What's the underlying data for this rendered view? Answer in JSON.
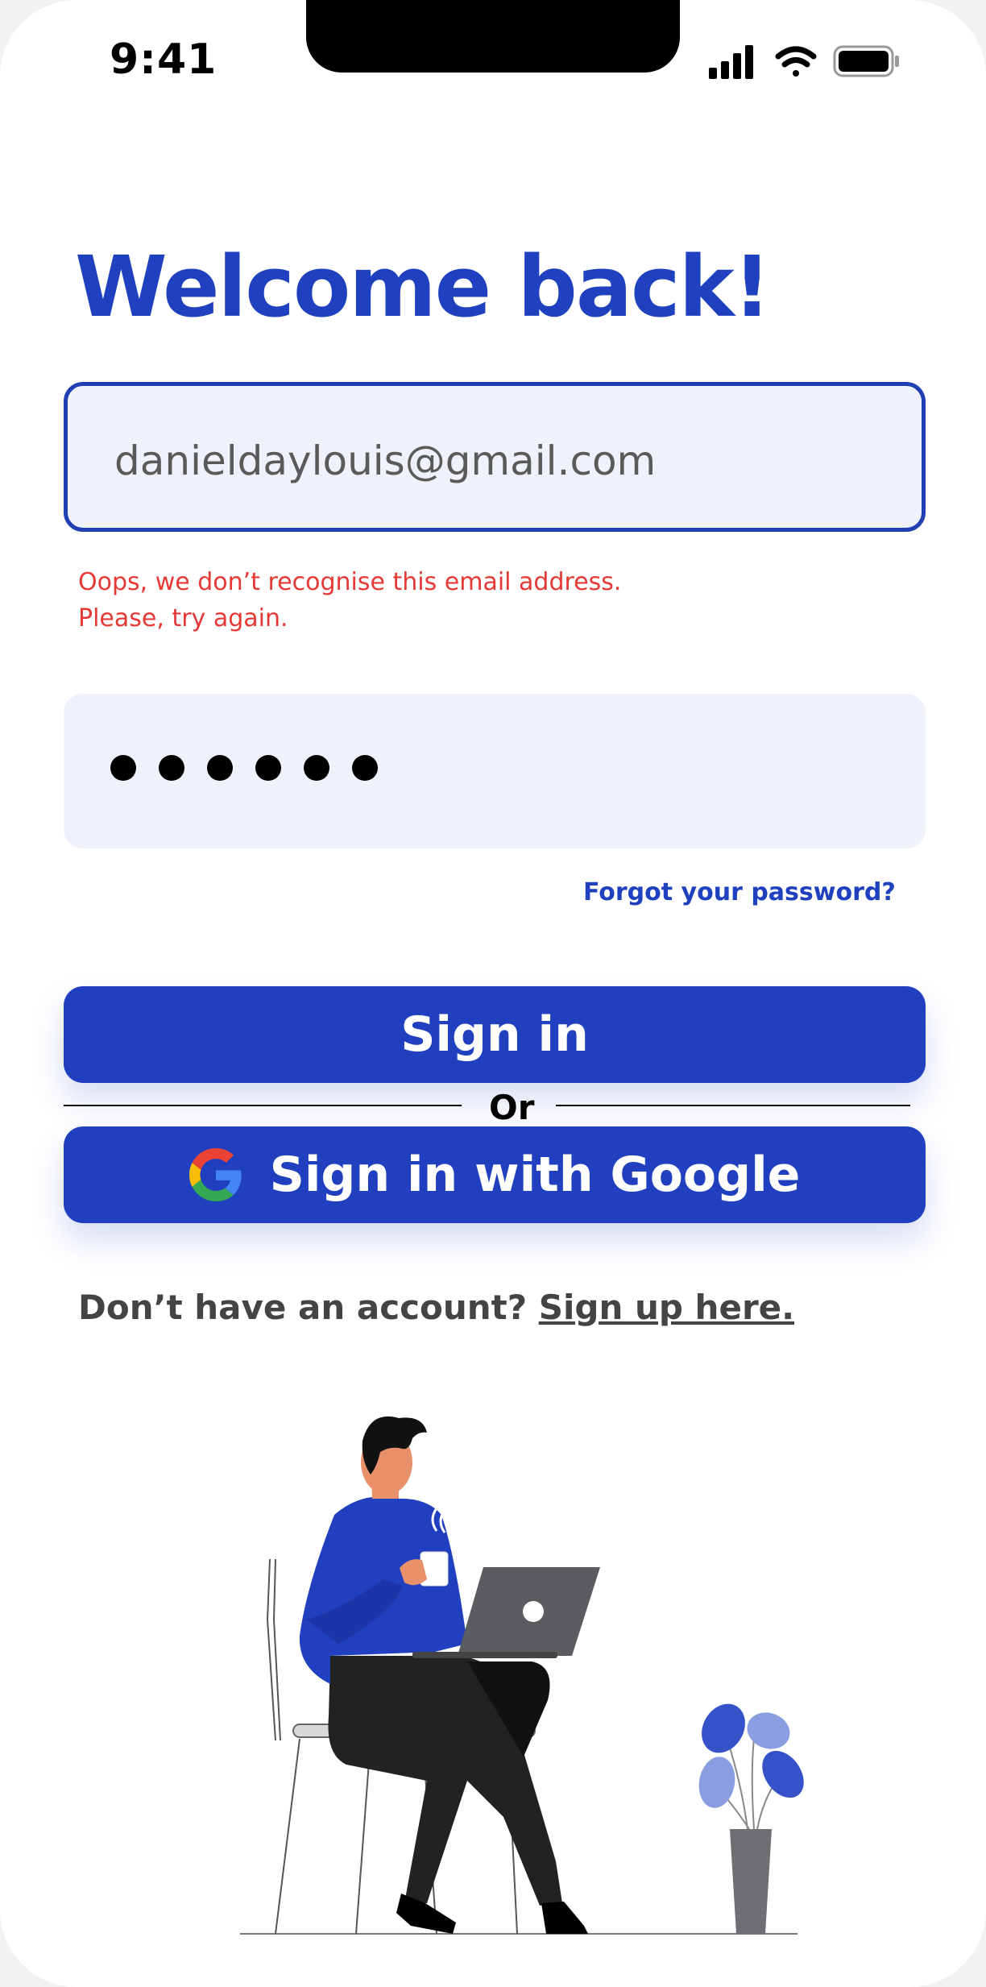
{
  "status_bar": {
    "time": "9:41"
  },
  "login": {
    "title": "Welcome back!",
    "email_value": "danieldaylouis@gmail.com",
    "error_line1": "Oops, we don’t recognise this email address.",
    "error_line2": "Please, try again.",
    "password_mask_length": 6,
    "forgot_label": "Forgot your password?",
    "signin_label": "Sign in",
    "or_label": "Or",
    "google_label": "Sign in with Google",
    "signup_prompt": "Don’t have an account?",
    "signup_link": "Sign up here."
  },
  "icons": {
    "cellular": "signal-bars-icon",
    "wifi": "wifi-icon",
    "battery": "battery-icon",
    "google": "google-logo-icon"
  },
  "colors": {
    "primary": "#2140bf",
    "title": "#1f40bf",
    "field_bg": "#eff2fd",
    "error": "#e53935"
  }
}
